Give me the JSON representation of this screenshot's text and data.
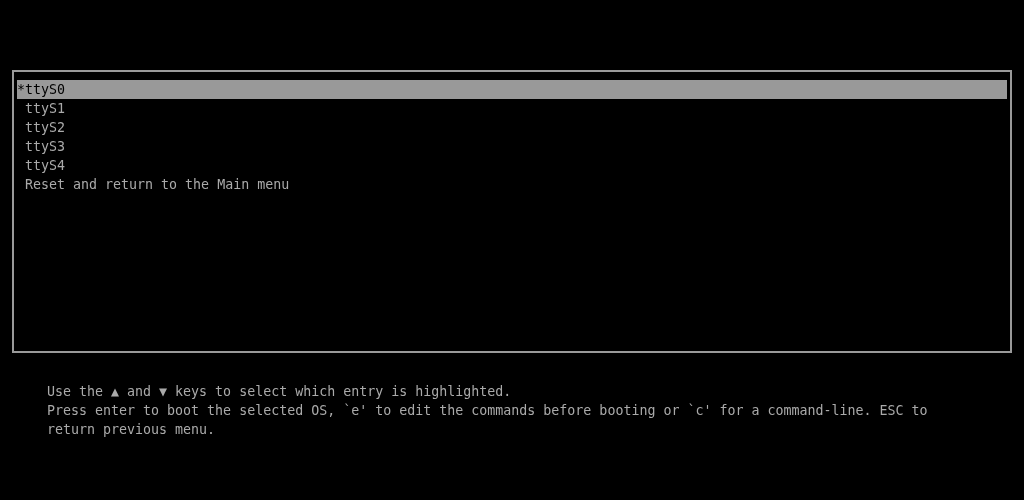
{
  "menu": {
    "selected_marker": "*",
    "entries": [
      {
        "label": "ttyS0",
        "selected": true
      },
      {
        "label": "ttyS1",
        "selected": false
      },
      {
        "label": "ttyS2",
        "selected": false
      },
      {
        "label": "ttyS3",
        "selected": false
      },
      {
        "label": "ttyS4",
        "selected": false
      },
      {
        "label": "Reset and return to the Main menu",
        "selected": false
      }
    ]
  },
  "help_lines": [
    "Use the ▲ and ▼ keys to select which entry is highlighted.",
    "Press enter to boot the selected OS, `e' to edit the commands before booting or `c' for a command-line. ESC to",
    "return previous menu."
  ]
}
